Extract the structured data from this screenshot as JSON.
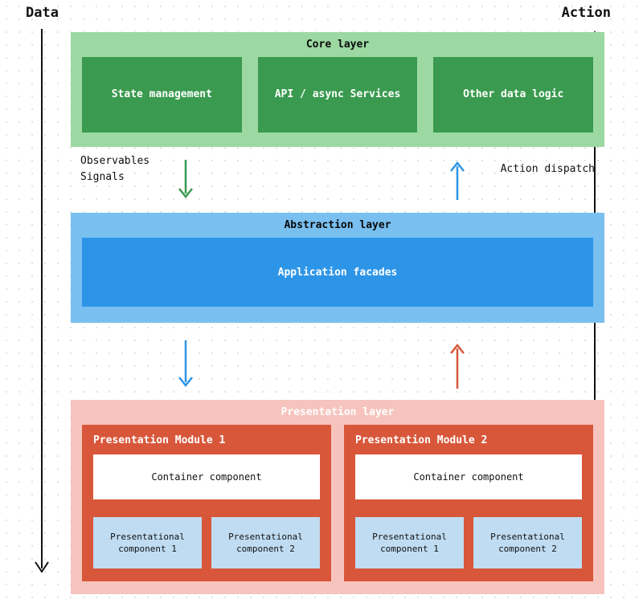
{
  "labels": {
    "data": "Data",
    "action": "Action"
  },
  "coreLayer": {
    "title": "Core layer",
    "boxes": {
      "state": "State management",
      "api": "API / async Services",
      "other": "Other data logic"
    }
  },
  "gap1": {
    "observables": "Observables",
    "signals": "Signals",
    "actionDispatch": "Action dispatch"
  },
  "abstractionLayer": {
    "title": "Abstraction layer",
    "facades": "Application facades"
  },
  "presentationLayer": {
    "title": "Presentation layer",
    "module1": {
      "title": "Presentation Module 1",
      "container": "Container component",
      "comp1": "Presentational component 1",
      "comp2": "Presentational component 2"
    },
    "module2": {
      "title": "Presentation Module 2",
      "container": "Container component",
      "comp1": "Presentational component 1",
      "comp2": "Presentational component 2"
    }
  },
  "colors": {
    "coreLight": "#9cd9a2",
    "coreDark": "#3a9a4f",
    "absLight": "#79bff0",
    "absDark": "#2d95e7",
    "presLight": "#f6c4bd",
    "presDark": "#d8573a",
    "presComp": "#bfdcf2",
    "arrowGreen": "#3a9a4f",
    "arrowBlue": "#2d95e7",
    "arrowRed": "#d8573a",
    "arrowBlack": "#111111"
  }
}
